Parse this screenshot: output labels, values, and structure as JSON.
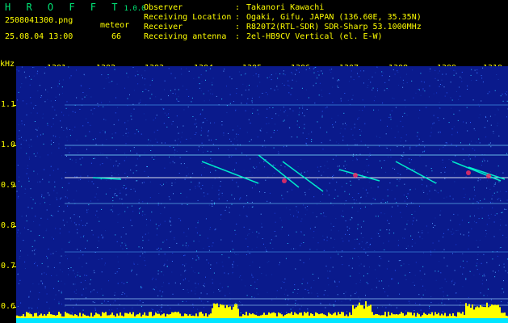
{
  "app": {
    "name": "H R O F F T",
    "version": "1.0.0"
  },
  "capture": {
    "filename": "2508041300.png",
    "datetime": "25.08.04 13:00",
    "meteor_label": "meteor",
    "meteor_count": "66"
  },
  "info": [
    {
      "label": "Observer",
      "value": "Takanori Kawachi"
    },
    {
      "label": "Receiving Location",
      "value": "Ogaki, Gifu, JAPAN (136.60E, 35.35N)"
    },
    {
      "label": "Receiver",
      "value": "R820T2(RTL-SDR) SDR-Sharp 53.1000MHz"
    },
    {
      "label": "Receiving antenna",
      "value": "2el-HB9CV Vertical (el. E-W)"
    }
  ],
  "axes": {
    "y_unit": "kHz",
    "x_ticks": [
      "1301",
      "1302",
      "1303",
      "1304",
      "1305",
      "1306",
      "1307",
      "1308",
      "1309",
      "1310"
    ],
    "y_ticks": [
      "1.1",
      "1.0",
      "0.9",
      "0.8",
      "0.7",
      "0.6"
    ]
  },
  "colors": {
    "background": "#000000",
    "label": "#ffff00",
    "logo": "#00e676",
    "noise_base": "#0a1a8c",
    "trace": "#00ffd0",
    "echo_hot": "#ff3060",
    "histogram": "#ffff00",
    "baseline": "#00e5ff"
  }
}
